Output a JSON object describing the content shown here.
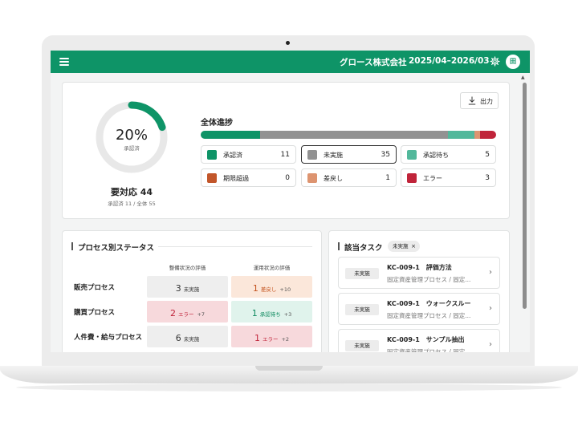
{
  "header": {
    "company": "グロース株式会社",
    "period": "2025/04–2026/03",
    "avatar": "田"
  },
  "summary": {
    "percent_text": "20%",
    "percent_value": 0.2,
    "percent_label": "承認済",
    "pending_text": "要対応 44",
    "pending_sub": "承認済 11 / 全体 55",
    "export_label": "出力",
    "overall_title": "全体進捗",
    "stats": [
      {
        "name": "承認済",
        "count": "11",
        "color": "#0e9467",
        "value": 11
      },
      {
        "name": "未実施",
        "count": "35",
        "color": "#929292",
        "value": 35,
        "selected": true
      },
      {
        "name": "承認待ち",
        "count": "5",
        "color": "#52b89b",
        "value": 5
      },
      {
        "name": "期限超過",
        "count": "0",
        "color": "#c2562a",
        "value": 0
      },
      {
        "name": "差戻し",
        "count": "1",
        "color": "#dd9470",
        "value": 1
      },
      {
        "name": "エラー",
        "count": "3",
        "color": "#c0243a",
        "value": 3
      }
    ]
  },
  "process": {
    "title": "プロセス別ステータス",
    "col1": "整備状況の評価",
    "col2": "運用状況の評価",
    "rows": [
      {
        "name": "販売プロセス",
        "c1": {
          "num": "3",
          "status": "未実施",
          "delta": ""
        },
        "c2": {
          "num": "1",
          "status": "差戻し",
          "delta": "+10"
        }
      },
      {
        "name": "購買プロセス",
        "c1": {
          "num": "2",
          "status": "エラー",
          "delta": "+7"
        },
        "c2": {
          "num": "1",
          "status": "承認待ち",
          "delta": "+3"
        }
      },
      {
        "name": "人件費・給与プロセス",
        "c1": {
          "num": "6",
          "status": "未実施",
          "delta": ""
        },
        "c2": {
          "num": "1",
          "status": "エラー",
          "delta": "+2"
        }
      }
    ]
  },
  "tasks": {
    "title": "該当タスク",
    "filter": "未実施",
    "items": [
      {
        "badge": "未実施",
        "title": "KC-009-1　評価方法",
        "sub": "固定資産管理プロセス / 固定..."
      },
      {
        "badge": "未実施",
        "title": "KC-009-1　ウォークスルー",
        "sub": "固定資産管理プロセス / 固定..."
      },
      {
        "badge": "未実施",
        "title": "KC-009-1　サンプル抽出",
        "sub": "固定資産管理プロセス / 固定..."
      }
    ]
  }
}
